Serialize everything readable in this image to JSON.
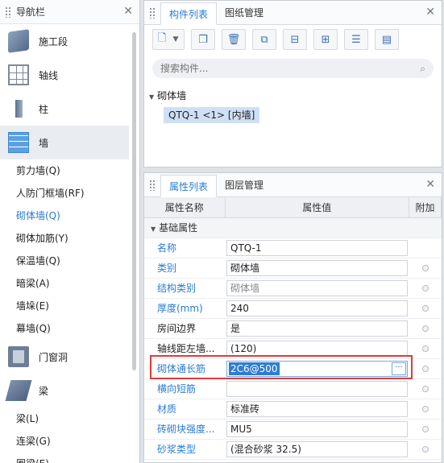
{
  "nav": {
    "title": "导航栏",
    "categories_top": [
      {
        "label": "施工段",
        "icon": "stage-icon"
      },
      {
        "label": "轴线",
        "icon": "axis-grid-icon"
      },
      {
        "label": "柱",
        "icon": "column-icon"
      },
      {
        "label": "墙",
        "icon": "wall-icon",
        "active": true
      }
    ],
    "wall_items": [
      "剪力墙(Q)",
      "人防门框墙(RF)",
      "砌体墙(Q)",
      "砌体加筋(Y)",
      "保温墙(Q)",
      "暗梁(A)",
      "墙垛(E)",
      "幕墙(Q)"
    ],
    "categories_bottom": [
      {
        "label": "门窗洞",
        "icon": "door-window-icon"
      },
      {
        "label": "梁",
        "icon": "beam-icon"
      }
    ],
    "beam_items": [
      "梁(L)",
      "连梁(G)",
      "圈梁(E)"
    ]
  },
  "component_panel": {
    "tabs": [
      "构件列表",
      "图纸管理"
    ],
    "search_placeholder": "搜索构件...",
    "tree": {
      "group": "砌体墙",
      "item": "QTQ-1 <1> [内墙]"
    }
  },
  "property_panel": {
    "tabs": [
      "属性列表",
      "图层管理"
    ],
    "headers": [
      "属性名称",
      "属性值",
      "附加"
    ],
    "group": "基础属性",
    "rows": [
      {
        "name": "名称",
        "value": "QTQ-1",
        "blue": true,
        "flag": false
      },
      {
        "name": "类别",
        "value": "砌体墙",
        "blue": true,
        "flag": true
      },
      {
        "name": "结构类别",
        "value": "砌体墙",
        "blue": true,
        "flag": true,
        "gray": true
      },
      {
        "name": "厚度(mm)",
        "value": "240",
        "blue": true,
        "flag": true
      },
      {
        "name": "房间边界",
        "value": "是",
        "blue": false,
        "flag": true
      },
      {
        "name": "轴线距左墙...",
        "value": "(120)",
        "blue": false,
        "flag": true
      },
      {
        "name": "砌体通长筋",
        "value": "2C6@500",
        "blue": true,
        "flag": true,
        "editing": true
      },
      {
        "name": "横向短筋",
        "value": "",
        "blue": true,
        "flag": true
      },
      {
        "name": "材质",
        "value": "标准砖",
        "blue": true,
        "flag": true
      },
      {
        "name": "砖砌块强度...",
        "value": "MU5",
        "blue": true,
        "flag": true
      },
      {
        "name": "砂浆类型",
        "value": "(混合砂浆  32.5)",
        "blue": true,
        "flag": true
      }
    ],
    "edit_button": "···"
  },
  "colors": {
    "accent": "#2a7bd6",
    "highlight": "#e23a3a",
    "selection": "#2f7cd5"
  }
}
